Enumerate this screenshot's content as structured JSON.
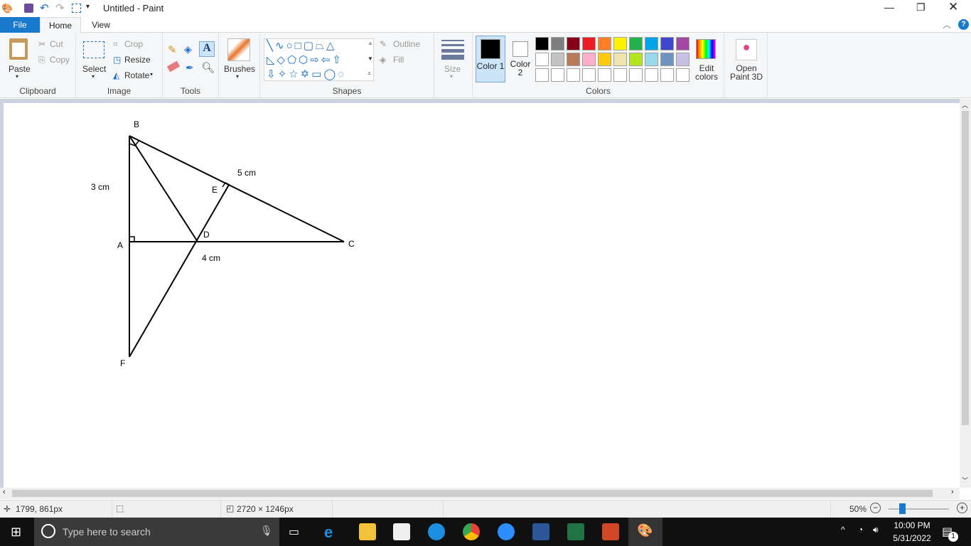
{
  "window": {
    "title": "Untitled - Paint"
  },
  "tabs": [
    {
      "label": "File"
    },
    {
      "label": "Home"
    },
    {
      "label": "View"
    }
  ],
  "ribbon": {
    "clipboard": {
      "label": "Clipboard",
      "paste": "Paste",
      "cut": "Cut",
      "copy": "Copy"
    },
    "image": {
      "label": "Image",
      "select": "Select",
      "crop": "Crop",
      "resize": "Resize",
      "rotate": "Rotate"
    },
    "tools": {
      "label": "Tools"
    },
    "brushes": {
      "label": "Brushes"
    },
    "shapes": {
      "label": "Shapes",
      "outline": "Outline",
      "fill": "Fill"
    },
    "size": {
      "label": "Size"
    },
    "colors": {
      "label": "Colors",
      "color1": "Color 1",
      "color2": "Color 2",
      "edit": "Edit colors",
      "color1_value": "#000000",
      "color2_value": "#ffffff",
      "palette": [
        "#000000",
        "#7f7f7f",
        "#880015",
        "#ed1c24",
        "#ff7f27",
        "#fff200",
        "#22b14c",
        "#00a2e8",
        "#3f48cc",
        "#a349a4",
        "#ffffff",
        "#c3c3c3",
        "#b97a57",
        "#ffaec9",
        "#ffc90e",
        "#efe4b0",
        "#b5e61d",
        "#99d9ea",
        "#7092be",
        "#c8bfe7"
      ]
    },
    "paint3d": {
      "label": "Open Paint 3D"
    }
  },
  "drawing": {
    "labels": {
      "B": "B",
      "A": "A",
      "C": "C",
      "D": "D",
      "E": "E",
      "F": "F",
      "ab": "3 cm",
      "bc": "5 cm",
      "ac": "4 cm"
    }
  },
  "status": {
    "cursor": "1799, 861px",
    "canvas_size": "2720 × 1246px",
    "zoom": "50%",
    "zoom_level": 50
  },
  "taskbar": {
    "search_placeholder": "Type here to search",
    "time": "10:00 PM",
    "date": "5/31/2022",
    "notifications": "1"
  }
}
